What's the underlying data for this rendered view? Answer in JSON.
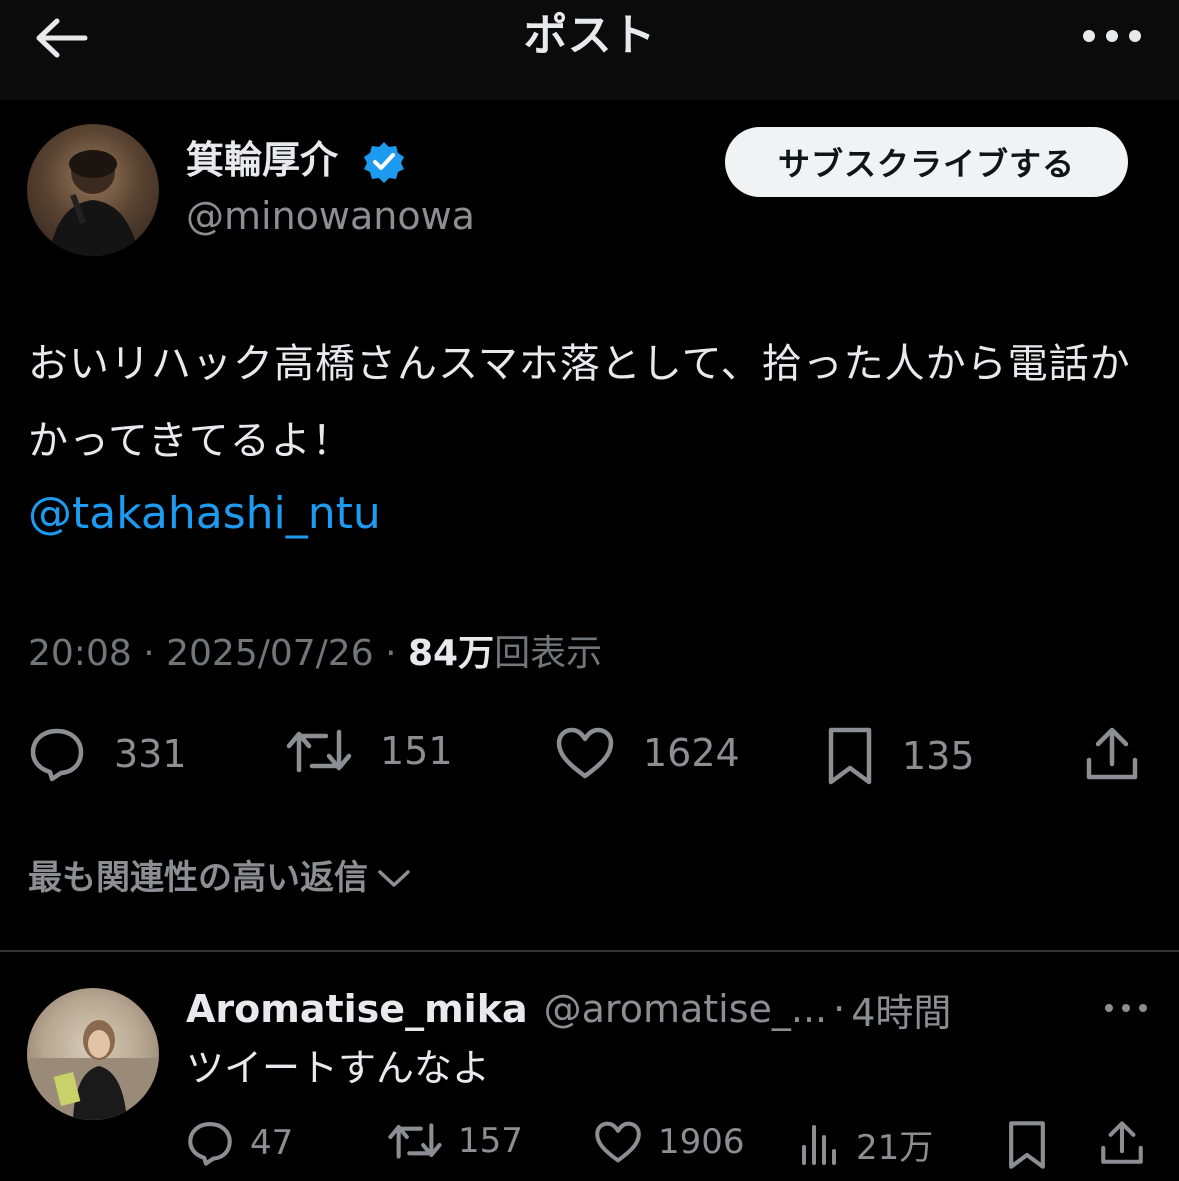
{
  "header": {
    "title": "ポスト",
    "back_icon": "arrow-left-icon",
    "more_icon": "more-horizontal-icon"
  },
  "post": {
    "author_name": "箕輪厚介",
    "author_handle": "@minowanowa",
    "verified": true,
    "subscribe_label": "サブスクライブする",
    "text": "おいリハック高橋さんスマホ落として、拾った人から電話かかってきてるよ！",
    "mention": "@takahashi_ntu",
    "time": "20:08",
    "separator": "·",
    "date": "2025/07/26",
    "views_count": "84万",
    "views_label": "回表示",
    "stats": {
      "replies": "331",
      "retweets": "151",
      "likes": "1624",
      "bookmarks": "135"
    }
  },
  "replies_sort": {
    "label": "最も関連性の高い返信"
  },
  "reply": {
    "author_name": "Aromatise_mika",
    "author_handle": "@aromatise_...",
    "separator": "·",
    "time": "4時間",
    "text": "ツイートすんなよ",
    "stats": {
      "replies": "47",
      "retweets": "157",
      "likes": "1906",
      "views": "21万"
    }
  },
  "colors": {
    "background": "#000000",
    "text": "#e7e9ea",
    "secondary": "#71767b",
    "accent": "#1d9bf0",
    "button_bg": "#eff3f4"
  }
}
